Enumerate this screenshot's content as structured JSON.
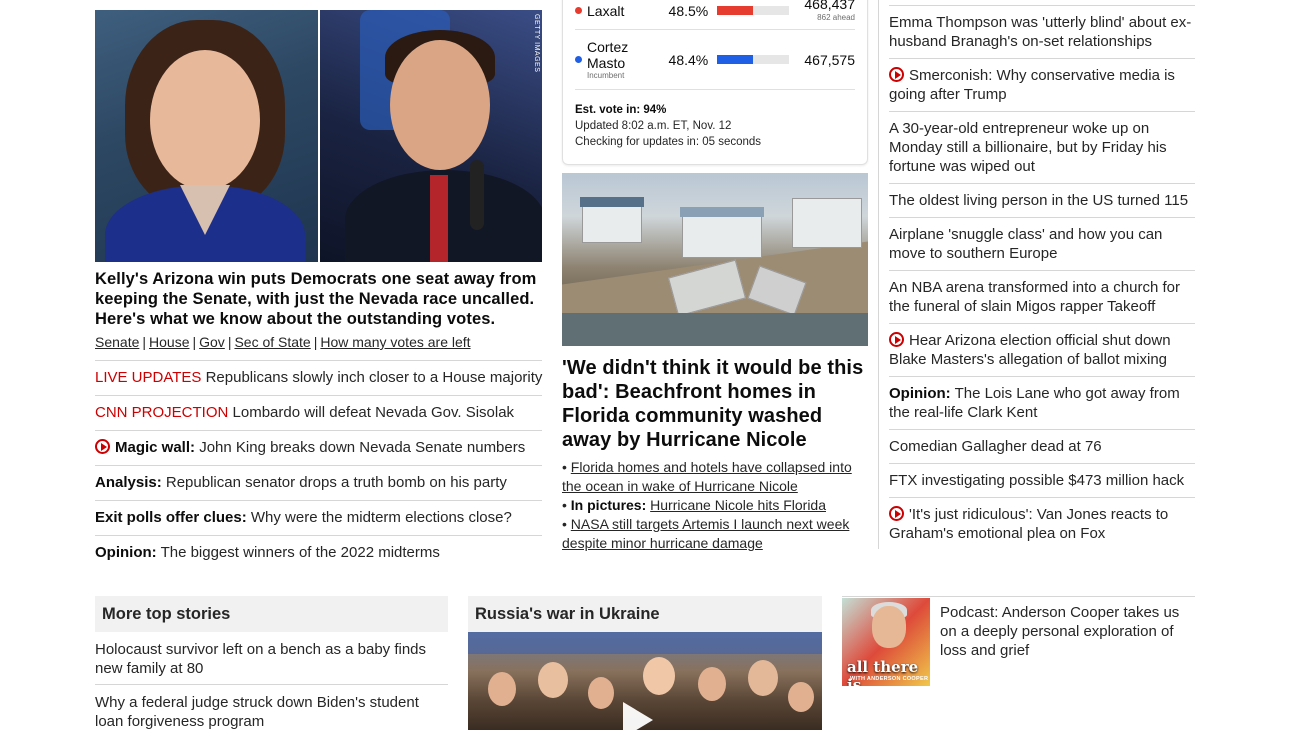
{
  "lead": {
    "image_credit": "GETTY IMAGES",
    "headline": "Kelly's Arizona win puts Democrats one seat away from keeping the Senate, with just the Nevada race uncalled. Here's what we know about the outstanding votes.",
    "sublinks": [
      "Senate",
      "House",
      "Gov",
      "Sec of State",
      "How many votes are left"
    ],
    "items": [
      {
        "prefix": "LIVE UPDATES",
        "text": "Republicans slowly inch closer to a House majority"
      },
      {
        "prefix": "CNN PROJECTION",
        "text": "Lombardo will defeat Nevada Gov. Sisolak"
      },
      {
        "bold": "Magic wall:",
        "text": "John King breaks down Nevada Senate numbers"
      },
      {
        "bold": "Analysis:",
        "text": "Republican senator drops a truth bomb on his party"
      },
      {
        "bold": "Exit polls offer clues:",
        "text": "Why were the midterm elections close?"
      },
      {
        "bold": "Opinion:",
        "text": "The biggest winners of the 2022 midterms"
      }
    ]
  },
  "election": {
    "candidates": [
      {
        "name": "Laxalt",
        "note": "",
        "pct": "48.5%",
        "share": 48.5,
        "votes": "468,437",
        "ahead": "862 ahead",
        "color": "#e63c2f"
      },
      {
        "name": "Cortez Masto",
        "note": "Incumbent",
        "pct": "48.4%",
        "share": 48.4,
        "votes": "467,575",
        "ahead": "",
        "color": "#1f5fe5"
      }
    ],
    "est_label": "Est. vote in: 94%",
    "updated": "Updated 8:02 a.m. ET, Nov. 12",
    "checking": "Checking for updates in: 05 seconds"
  },
  "florida": {
    "headline": "'We didn't think it would be this bad': Beachfront homes in Florida community washed away by Hurricane Nicole",
    "bullet1": "Florida homes and hotels have collapsed into the ocean in wake of Hurricane Nicole",
    "bullet2_bold": "In pictures:",
    "bullet2": "Hurricane Nicole hits Florida",
    "bullet3": "NASA still targets Artemis I launch next week despite minor hurricane damage"
  },
  "right": [
    {
      "text": "Emma Thompson was 'utterly blind' about ex-husband Branagh's on-set relationships"
    },
    {
      "video": true,
      "text": "Smerconish: Why conservative media is going after Trump"
    },
    {
      "text": "A 30-year-old entrepreneur woke up on Monday still a billionaire, but by Friday his fortune was wiped out"
    },
    {
      "text": "The oldest living person in the US turned 115"
    },
    {
      "text": "Airplane 'snuggle class' and how you can move to southern Europe"
    },
    {
      "text": "An NBA arena transformed into a church for the funeral of slain Migos rapper Takeoff"
    },
    {
      "video": true,
      "text": "Hear Arizona election official shut down Blake Masters's allegation of ballot mixing"
    },
    {
      "bold": "Opinion:",
      "text": "The Lois Lane who got away from the real-life Clark Kent"
    },
    {
      "text": "Comedian Gallagher dead at 76"
    },
    {
      "text": "FTX investigating possible $473 million hack"
    },
    {
      "video": true,
      "text": "'It's just ridiculous': Van Jones reacts to Graham's emotional plea on Fox"
    }
  ],
  "more": {
    "title": "More top stories",
    "items": [
      "Holocaust survivor left on a bench as a baby finds new family at 80",
      "Why a federal judge struck down Biden's student loan forgiveness program"
    ]
  },
  "ukraine": {
    "title": "Russia's war in Ukraine"
  },
  "podcast": {
    "art_title": "all there is",
    "art_sub": "WITH ANDERSON COOPER",
    "text": "Podcast: Anderson Cooper takes us on a deeply personal exploration of loss and grief"
  }
}
